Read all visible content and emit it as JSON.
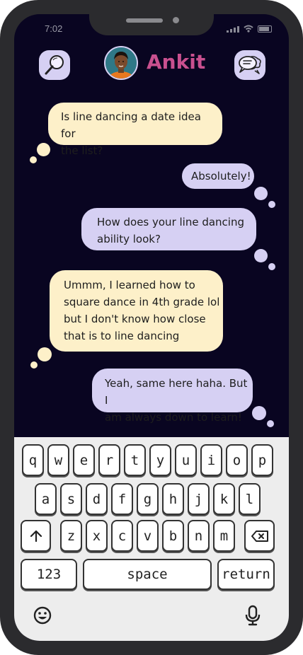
{
  "status_bar": {
    "time": "7:02"
  },
  "header": {
    "contact_name": "Ankit",
    "search_icon": "magnifying-glass-icon",
    "chat_icon": "speech-bubbles-icon"
  },
  "messages": [
    {
      "from": "contact",
      "lines": [
        "Is line dancing a date idea for",
        "the list?"
      ]
    },
    {
      "from": "me",
      "lines": [
        "Absolutely!"
      ]
    },
    {
      "from": "me",
      "lines": [
        "How does your line dancing",
        "ability look?"
      ]
    },
    {
      "from": "contact",
      "lines": [
        "Ummm, I learned how to",
        "square dance in 4th grade lol",
        "but I don't know how close",
        "that is to line dancing"
      ]
    },
    {
      "from": "me",
      "lines": [
        "Yeah, same here haha. But I",
        "am always down to learn!"
      ]
    }
  ],
  "keyboard": {
    "row1": [
      "q",
      "w",
      "e",
      "r",
      "t",
      "y",
      "u",
      "i",
      "o",
      "p"
    ],
    "row2": [
      "a",
      "s",
      "d",
      "f",
      "g",
      "h",
      "j",
      "k",
      "l"
    ],
    "row3": [
      "z",
      "x",
      "c",
      "v",
      "b",
      "n",
      "m"
    ],
    "numbers_label": "123",
    "space_label": "space",
    "return_label": "return",
    "shift_icon": "shift-arrow-icon",
    "backspace_icon": "backspace-icon",
    "emoji_icon": "emoji-icon",
    "mic_icon": "microphone-icon"
  },
  "colors": {
    "screen_bg": "#090521",
    "received_bubble": "#fdf0c9",
    "sent_bubble": "#d6d0f3",
    "name": "#c9508f",
    "keyboard_bg": "#ededed"
  }
}
